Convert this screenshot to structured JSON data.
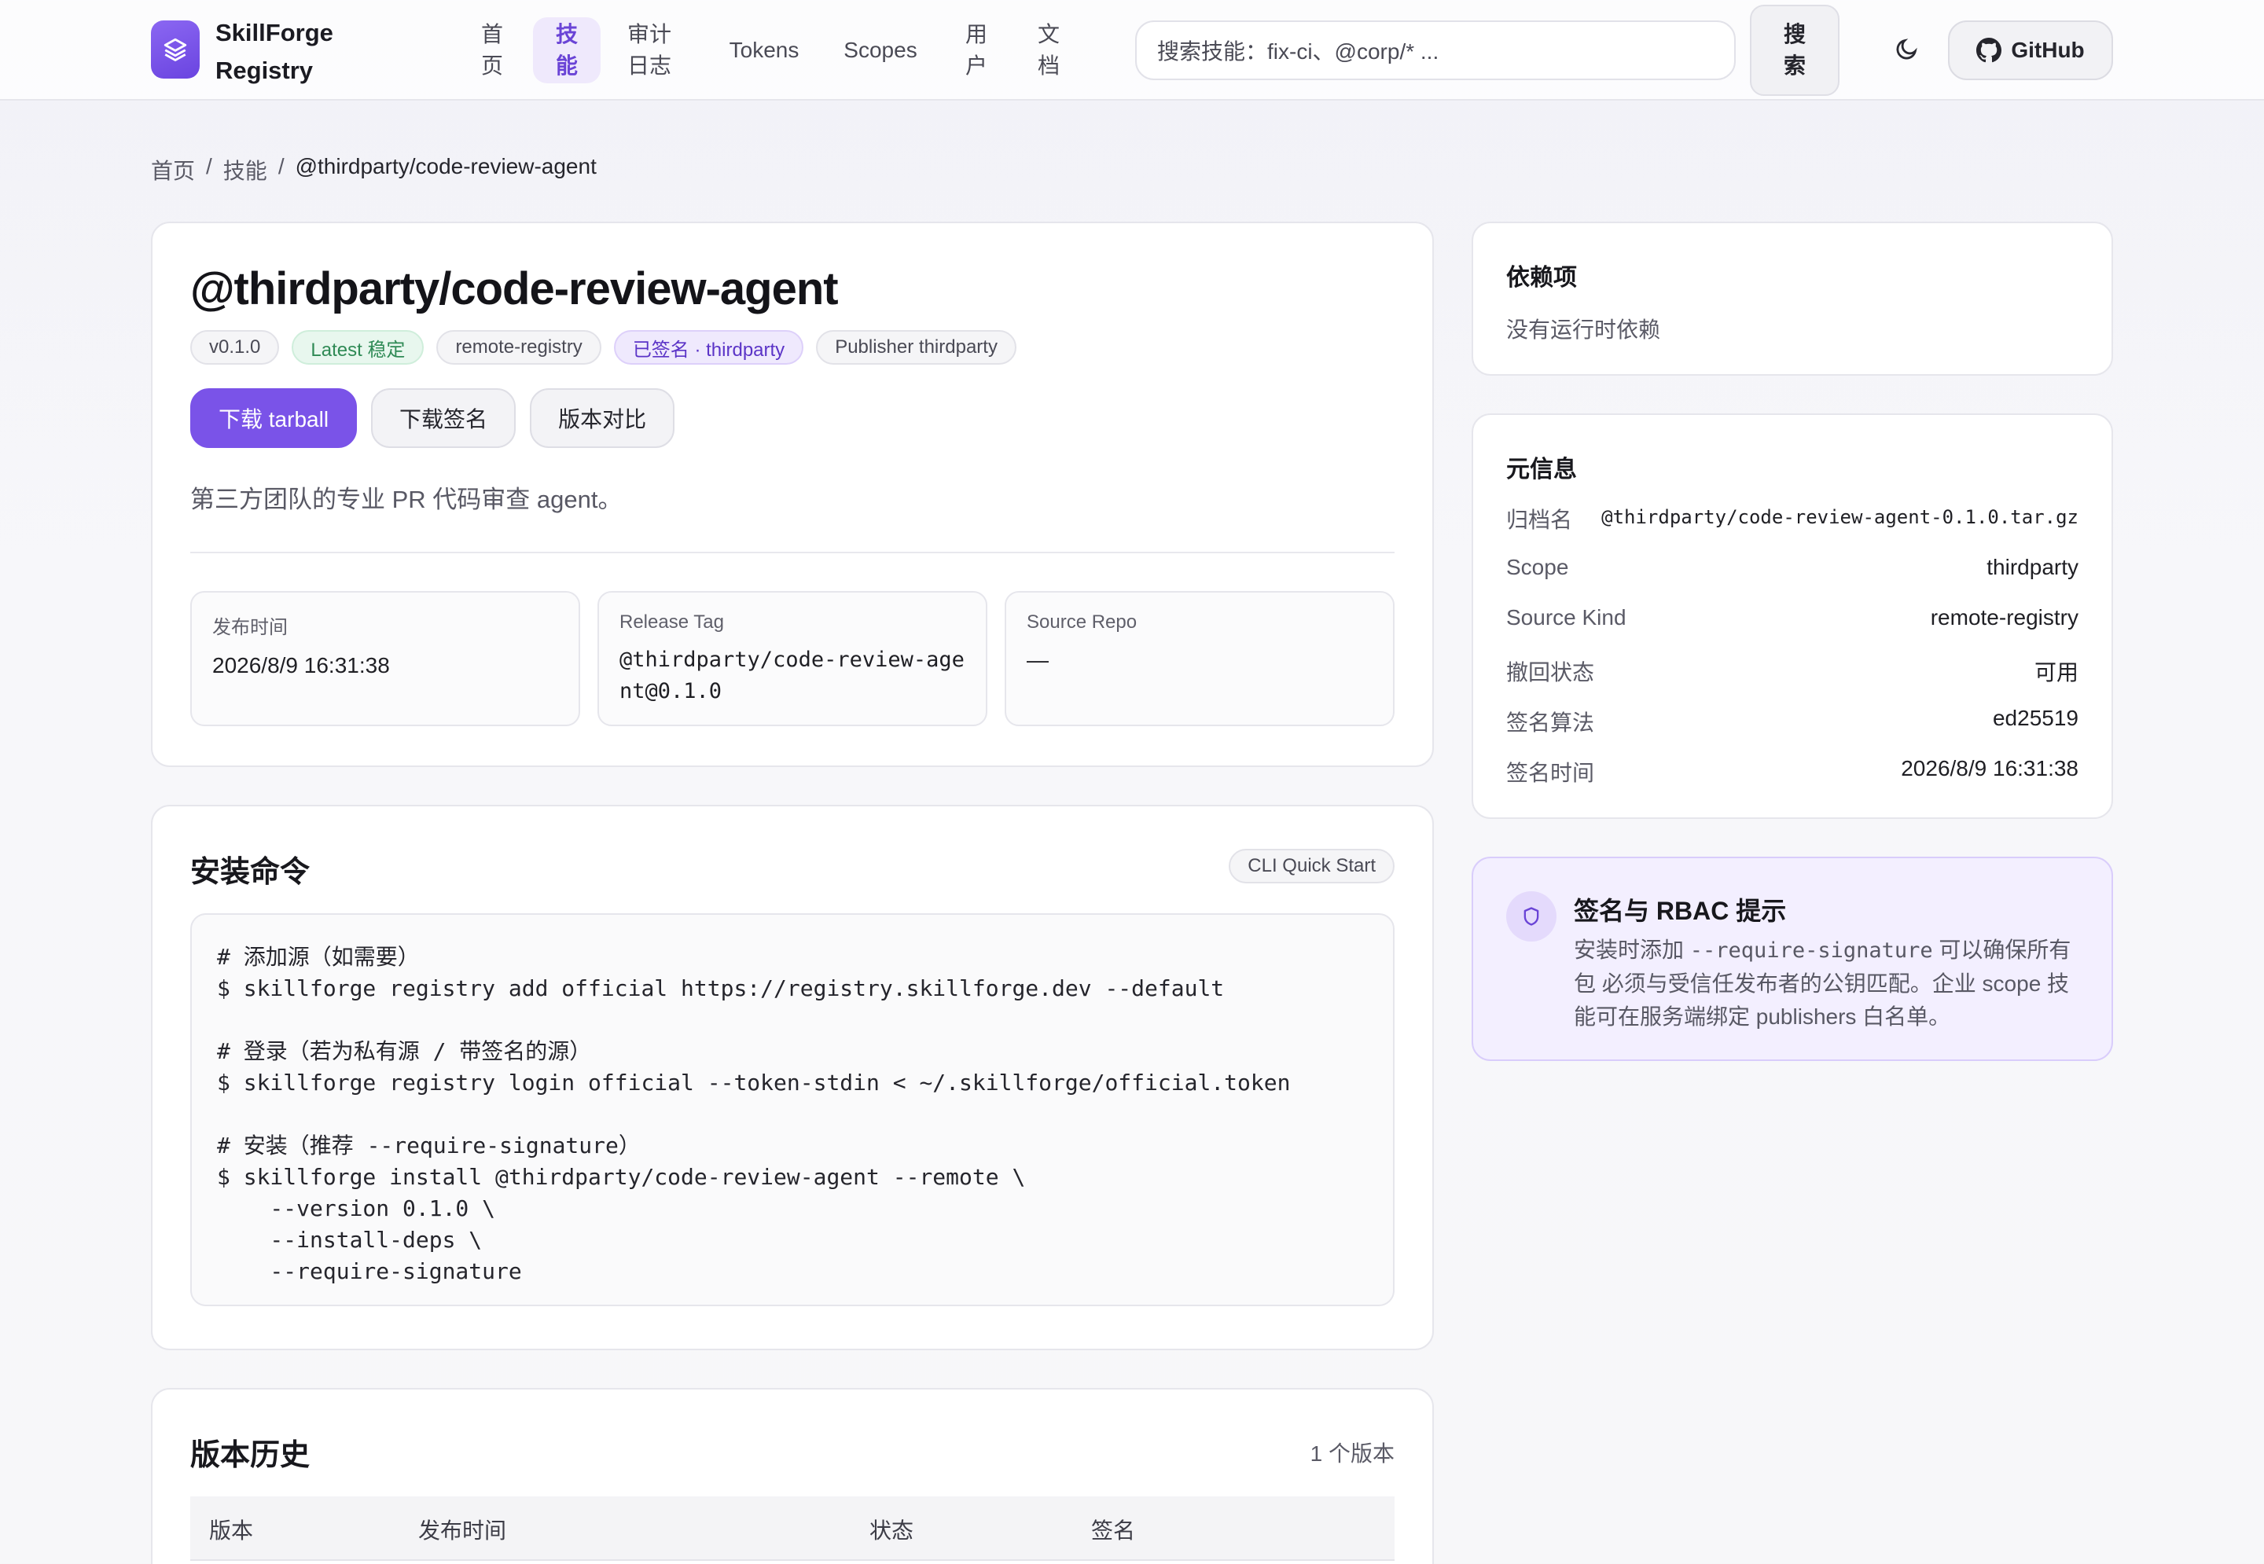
{
  "nav": {
    "brand": "SkillForge Registry",
    "links": [
      "首页",
      "技能",
      "审计日志",
      "Tokens",
      "Scopes",
      "用户",
      "文档"
    ],
    "active_index": 1,
    "search_placeholder": "搜索技能：fix-ci、@corp/* ...",
    "search_button": "搜索",
    "github": "GitHub"
  },
  "breadcrumb": [
    "首页",
    "技能",
    "@thirdparty/code-review-agent"
  ],
  "skill": {
    "name": "@thirdparty/code-review-agent",
    "badges": [
      "v0.1.0",
      "Latest 稳定",
      "remote-registry",
      "已签名 · thirdparty",
      "Publisher thirdparty"
    ],
    "actions": [
      "下载 tarball",
      "下载签名",
      "版本对比"
    ],
    "description": "第三方团队的专业 PR 代码审查 agent。",
    "stats": [
      {
        "label": "发布时间",
        "value": "2026/8/9 16:31:38"
      },
      {
        "label": "Release Tag",
        "value": "@thirdparty/code-review-agent@0.1.0"
      },
      {
        "label": "Source Repo",
        "value": "—"
      }
    ]
  },
  "install": {
    "title": "安装命令",
    "chip": "CLI Quick Start",
    "lines": [
      "# 添加源（如需要）",
      "$ skillforge registry add official https://registry.skillforge.dev --default",
      "",
      "# 登录（若为私有源 / 带签名的源）",
      "$ skillforge registry login official --token-stdin < ~/.skillforge/official.token",
      "",
      "# 安装（推荐 --require-signature）",
      "$ skillforge install @thirdparty/code-review-agent --remote \\",
      "    --version 0.1.0 \\",
      "    --install-deps \\",
      "    --require-signature"
    ]
  },
  "history": {
    "title": "版本历史",
    "count": "1 个版本",
    "columns": [
      "版本",
      "发布时间",
      "状态",
      "签名"
    ]
  },
  "deps": {
    "title": "依赖项",
    "empty": "没有运行时依赖"
  },
  "meta": {
    "title": "元信息",
    "rows": [
      {
        "k": "归档名",
        "v": "@thirdparty/code-review-agent-0.1.0.tar.gz"
      },
      {
        "k": "Scope",
        "v": "thirdparty"
      },
      {
        "k": "Source Kind",
        "v": "remote-registry"
      },
      {
        "k": "撤回状态",
        "v": "可用"
      },
      {
        "k": "签名算法",
        "v": "ed25519"
      },
      {
        "k": "签名时间",
        "v": "2026/8/9 16:31:38"
      }
    ]
  },
  "rbac": {
    "title": "签名与 RBAC 提示",
    "text_before": "安装时添加 ",
    "flag": "--require-signature",
    "text_after": " 可以确保所有包 必须与受信任发布者的公钥匹配。企业 scope 技能可在服务端绑定 publishers 白名单。"
  },
  "colors": {
    "accent": "#7a53e8",
    "success": "#2f8a55",
    "signed": "#5b34c7"
  },
  "icons": [
    "logo-layers-icon",
    "moon-icon",
    "github-icon",
    "shield-icon"
  ]
}
